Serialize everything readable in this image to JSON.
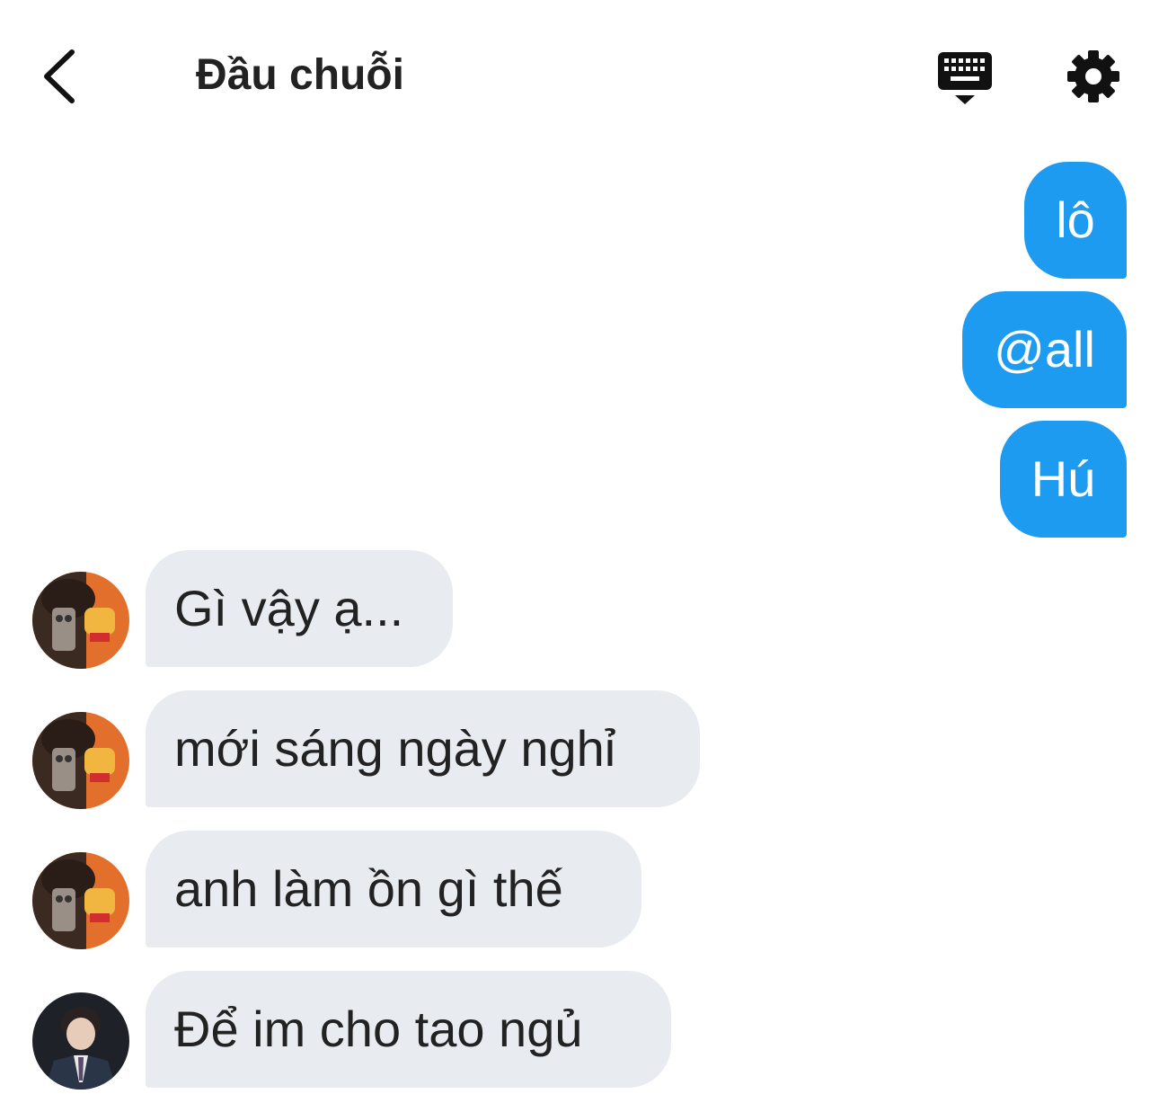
{
  "header": {
    "title": "Đầu chuỗi",
    "back_icon": "chevron-left-icon",
    "keyboard_icon": "keyboard-icon",
    "settings_icon": "gear-icon"
  },
  "colors": {
    "outgoing_bubble": "#1d9bf0",
    "incoming_bubble": "#e8ecf0",
    "text": "#222222"
  },
  "messages_outgoing": [
    {
      "text": "lô"
    },
    {
      "text": "@all"
    },
    {
      "text": "Hú"
    }
  ],
  "messages_incoming": [
    {
      "text": "Gì vậy ạ...",
      "avatar": "avatar-user-a"
    },
    {
      "text": "mới sáng ngày nghỉ",
      "avatar": "avatar-user-a"
    },
    {
      "text": "anh làm ồn gì thế",
      "avatar": "avatar-user-a"
    },
    {
      "text": "Để im cho tao ngủ",
      "avatar": "avatar-user-b"
    }
  ]
}
